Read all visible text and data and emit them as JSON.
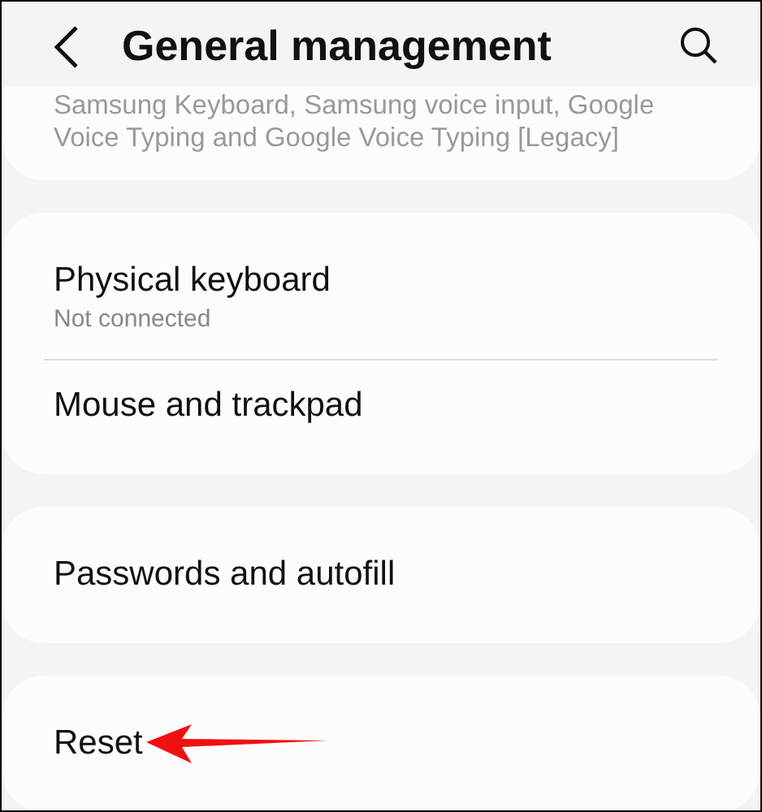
{
  "header": {
    "title": "General management"
  },
  "cards": [
    {
      "clipped": true,
      "items": [
        {
          "subtitle": "Samsung Keyboard, Samsung voice input, Google Voice Typing and Google Voice Typing [Legacy]"
        }
      ]
    },
    {
      "clipped": false,
      "items": [
        {
          "title": "Physical keyboard",
          "subtitle": "Not connected"
        },
        {
          "title": "Mouse and trackpad"
        }
      ]
    },
    {
      "clipped": false,
      "items": [
        {
          "title": "Passwords and autofill"
        }
      ]
    },
    {
      "clipped": false,
      "items": [
        {
          "title": "Reset",
          "pointed": true
        }
      ]
    }
  ]
}
